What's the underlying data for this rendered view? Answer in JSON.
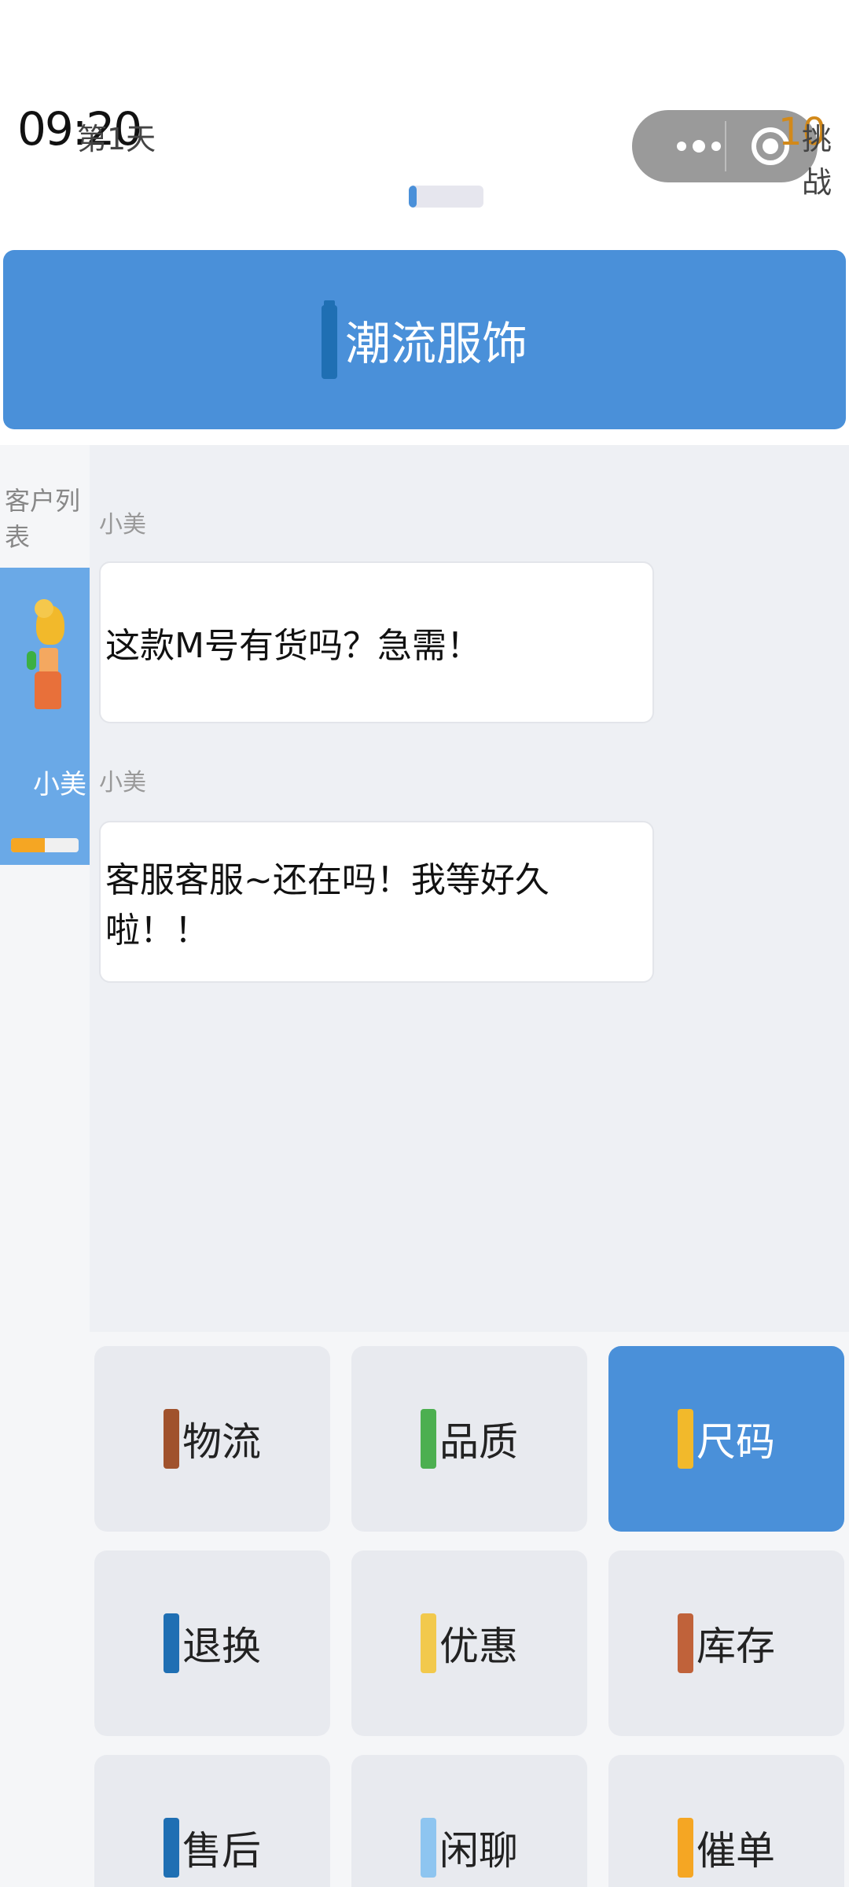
{
  "status": {
    "time": "09:20",
    "day_label": "第1天",
    "day_progress": 0.1,
    "goal_count": "10",
    "goal_label": "挑战"
  },
  "header": {
    "title": "潮流服饰",
    "icon": "shirt-icon"
  },
  "sidebar": {
    "title": "客户列表",
    "customers": [
      {
        "name": "小美",
        "icon": "avatar-icon",
        "mood": 0.5
      }
    ]
  },
  "chat": {
    "messages": [
      {
        "sender": "小美",
        "text": "这款M号有货吗？急需！"
      },
      {
        "sender": "小美",
        "text": "客服客服~还在吗！我等好久啦！！"
      }
    ]
  },
  "actions": [
    {
      "label": "物流",
      "icon": "box-icon",
      "color": "#a0522d",
      "active": false
    },
    {
      "label": "品质",
      "icon": "check-icon",
      "color": "#4caf50",
      "active": false
    },
    {
      "label": "尺码",
      "icon": "ruler-icon",
      "color": "#f2b92b",
      "active": true
    },
    {
      "label": "退换",
      "icon": "refresh-icon",
      "color": "#1f6fb3",
      "active": false
    },
    {
      "label": "优惠",
      "icon": "money-icon",
      "color": "#f2c94c",
      "active": false
    },
    {
      "label": "库存",
      "icon": "clipboard-icon",
      "color": "#c0623a",
      "active": false
    },
    {
      "label": "售后",
      "icon": "shield-icon",
      "color": "#1f6fb3",
      "active": false
    },
    {
      "label": "闲聊",
      "icon": "chat-bubble-icon",
      "color": "#8ec5f0",
      "active": false
    },
    {
      "label": "催单",
      "icon": "fire-icon",
      "color": "#f5a623",
      "active": false
    }
  ],
  "colors": {
    "accent": "#4a90d9",
    "customer_bg": "#6aa9e7",
    "mood": "#f5a623"
  }
}
